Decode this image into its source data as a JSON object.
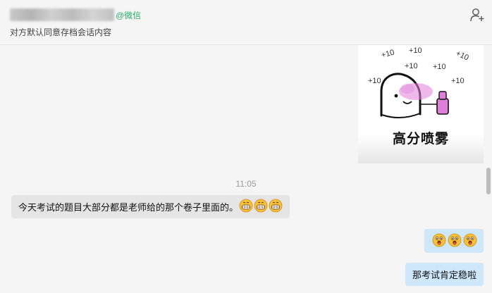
{
  "header": {
    "wechat_tag": "@微信",
    "subtitle": "对方默认同意存档会话内容",
    "add_icon": "add-contact-icon"
  },
  "sticker": {
    "plus_labels": [
      "+10",
      "+10",
      "+10",
      "+10",
      "+10",
      "+10",
      "+10"
    ],
    "caption": "高分喷雾"
  },
  "timestamp": "11:05",
  "messages": [
    {
      "side": "incoming",
      "text": "今天考试的题目大部分都是老师给的那个卷子里面的。",
      "emoji_count": 3,
      "emoji": "grinning-face-emoji"
    },
    {
      "side": "outgoing",
      "text": "",
      "emoji_count": 3,
      "emoji": "astonished-face-emoji"
    },
    {
      "side": "outgoing",
      "text": "那考试肯定稳啦"
    }
  ],
  "colors": {
    "incoming_bubble": "#e5e5e5",
    "outgoing_bubble": "#cfe7fb",
    "wechat_green": "#2aae67",
    "sticker_accent": "#e07fd9"
  }
}
